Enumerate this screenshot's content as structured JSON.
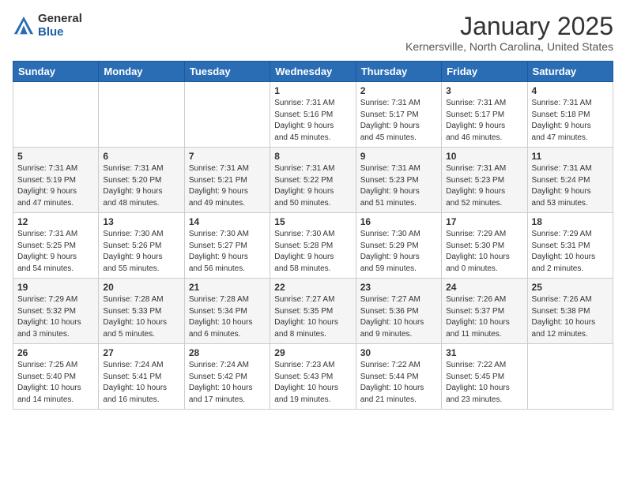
{
  "logo": {
    "general": "General",
    "blue": "Blue"
  },
  "header": {
    "month": "January 2025",
    "location": "Kernersville, North Carolina, United States"
  },
  "days_of_week": [
    "Sunday",
    "Monday",
    "Tuesday",
    "Wednesday",
    "Thursday",
    "Friday",
    "Saturday"
  ],
  "weeks": [
    [
      {
        "day": "",
        "info": ""
      },
      {
        "day": "",
        "info": ""
      },
      {
        "day": "",
        "info": ""
      },
      {
        "day": "1",
        "info": "Sunrise: 7:31 AM\nSunset: 5:16 PM\nDaylight: 9 hours\nand 45 minutes."
      },
      {
        "day": "2",
        "info": "Sunrise: 7:31 AM\nSunset: 5:17 PM\nDaylight: 9 hours\nand 45 minutes."
      },
      {
        "day": "3",
        "info": "Sunrise: 7:31 AM\nSunset: 5:17 PM\nDaylight: 9 hours\nand 46 minutes."
      },
      {
        "day": "4",
        "info": "Sunrise: 7:31 AM\nSunset: 5:18 PM\nDaylight: 9 hours\nand 47 minutes."
      }
    ],
    [
      {
        "day": "5",
        "info": "Sunrise: 7:31 AM\nSunset: 5:19 PM\nDaylight: 9 hours\nand 47 minutes."
      },
      {
        "day": "6",
        "info": "Sunrise: 7:31 AM\nSunset: 5:20 PM\nDaylight: 9 hours\nand 48 minutes."
      },
      {
        "day": "7",
        "info": "Sunrise: 7:31 AM\nSunset: 5:21 PM\nDaylight: 9 hours\nand 49 minutes."
      },
      {
        "day": "8",
        "info": "Sunrise: 7:31 AM\nSunset: 5:22 PM\nDaylight: 9 hours\nand 50 minutes."
      },
      {
        "day": "9",
        "info": "Sunrise: 7:31 AM\nSunset: 5:23 PM\nDaylight: 9 hours\nand 51 minutes."
      },
      {
        "day": "10",
        "info": "Sunrise: 7:31 AM\nSunset: 5:23 PM\nDaylight: 9 hours\nand 52 minutes."
      },
      {
        "day": "11",
        "info": "Sunrise: 7:31 AM\nSunset: 5:24 PM\nDaylight: 9 hours\nand 53 minutes."
      }
    ],
    [
      {
        "day": "12",
        "info": "Sunrise: 7:31 AM\nSunset: 5:25 PM\nDaylight: 9 hours\nand 54 minutes."
      },
      {
        "day": "13",
        "info": "Sunrise: 7:30 AM\nSunset: 5:26 PM\nDaylight: 9 hours\nand 55 minutes."
      },
      {
        "day": "14",
        "info": "Sunrise: 7:30 AM\nSunset: 5:27 PM\nDaylight: 9 hours\nand 56 minutes."
      },
      {
        "day": "15",
        "info": "Sunrise: 7:30 AM\nSunset: 5:28 PM\nDaylight: 9 hours\nand 58 minutes."
      },
      {
        "day": "16",
        "info": "Sunrise: 7:30 AM\nSunset: 5:29 PM\nDaylight: 9 hours\nand 59 minutes."
      },
      {
        "day": "17",
        "info": "Sunrise: 7:29 AM\nSunset: 5:30 PM\nDaylight: 10 hours\nand 0 minutes."
      },
      {
        "day": "18",
        "info": "Sunrise: 7:29 AM\nSunset: 5:31 PM\nDaylight: 10 hours\nand 2 minutes."
      }
    ],
    [
      {
        "day": "19",
        "info": "Sunrise: 7:29 AM\nSunset: 5:32 PM\nDaylight: 10 hours\nand 3 minutes."
      },
      {
        "day": "20",
        "info": "Sunrise: 7:28 AM\nSunset: 5:33 PM\nDaylight: 10 hours\nand 5 minutes."
      },
      {
        "day": "21",
        "info": "Sunrise: 7:28 AM\nSunset: 5:34 PM\nDaylight: 10 hours\nand 6 minutes."
      },
      {
        "day": "22",
        "info": "Sunrise: 7:27 AM\nSunset: 5:35 PM\nDaylight: 10 hours\nand 8 minutes."
      },
      {
        "day": "23",
        "info": "Sunrise: 7:27 AM\nSunset: 5:36 PM\nDaylight: 10 hours\nand 9 minutes."
      },
      {
        "day": "24",
        "info": "Sunrise: 7:26 AM\nSunset: 5:37 PM\nDaylight: 10 hours\nand 11 minutes."
      },
      {
        "day": "25",
        "info": "Sunrise: 7:26 AM\nSunset: 5:38 PM\nDaylight: 10 hours\nand 12 minutes."
      }
    ],
    [
      {
        "day": "26",
        "info": "Sunrise: 7:25 AM\nSunset: 5:40 PM\nDaylight: 10 hours\nand 14 minutes."
      },
      {
        "day": "27",
        "info": "Sunrise: 7:24 AM\nSunset: 5:41 PM\nDaylight: 10 hours\nand 16 minutes."
      },
      {
        "day": "28",
        "info": "Sunrise: 7:24 AM\nSunset: 5:42 PM\nDaylight: 10 hours\nand 17 minutes."
      },
      {
        "day": "29",
        "info": "Sunrise: 7:23 AM\nSunset: 5:43 PM\nDaylight: 10 hours\nand 19 minutes."
      },
      {
        "day": "30",
        "info": "Sunrise: 7:22 AM\nSunset: 5:44 PM\nDaylight: 10 hours\nand 21 minutes."
      },
      {
        "day": "31",
        "info": "Sunrise: 7:22 AM\nSunset: 5:45 PM\nDaylight: 10 hours\nand 23 minutes."
      },
      {
        "day": "",
        "info": ""
      }
    ]
  ]
}
